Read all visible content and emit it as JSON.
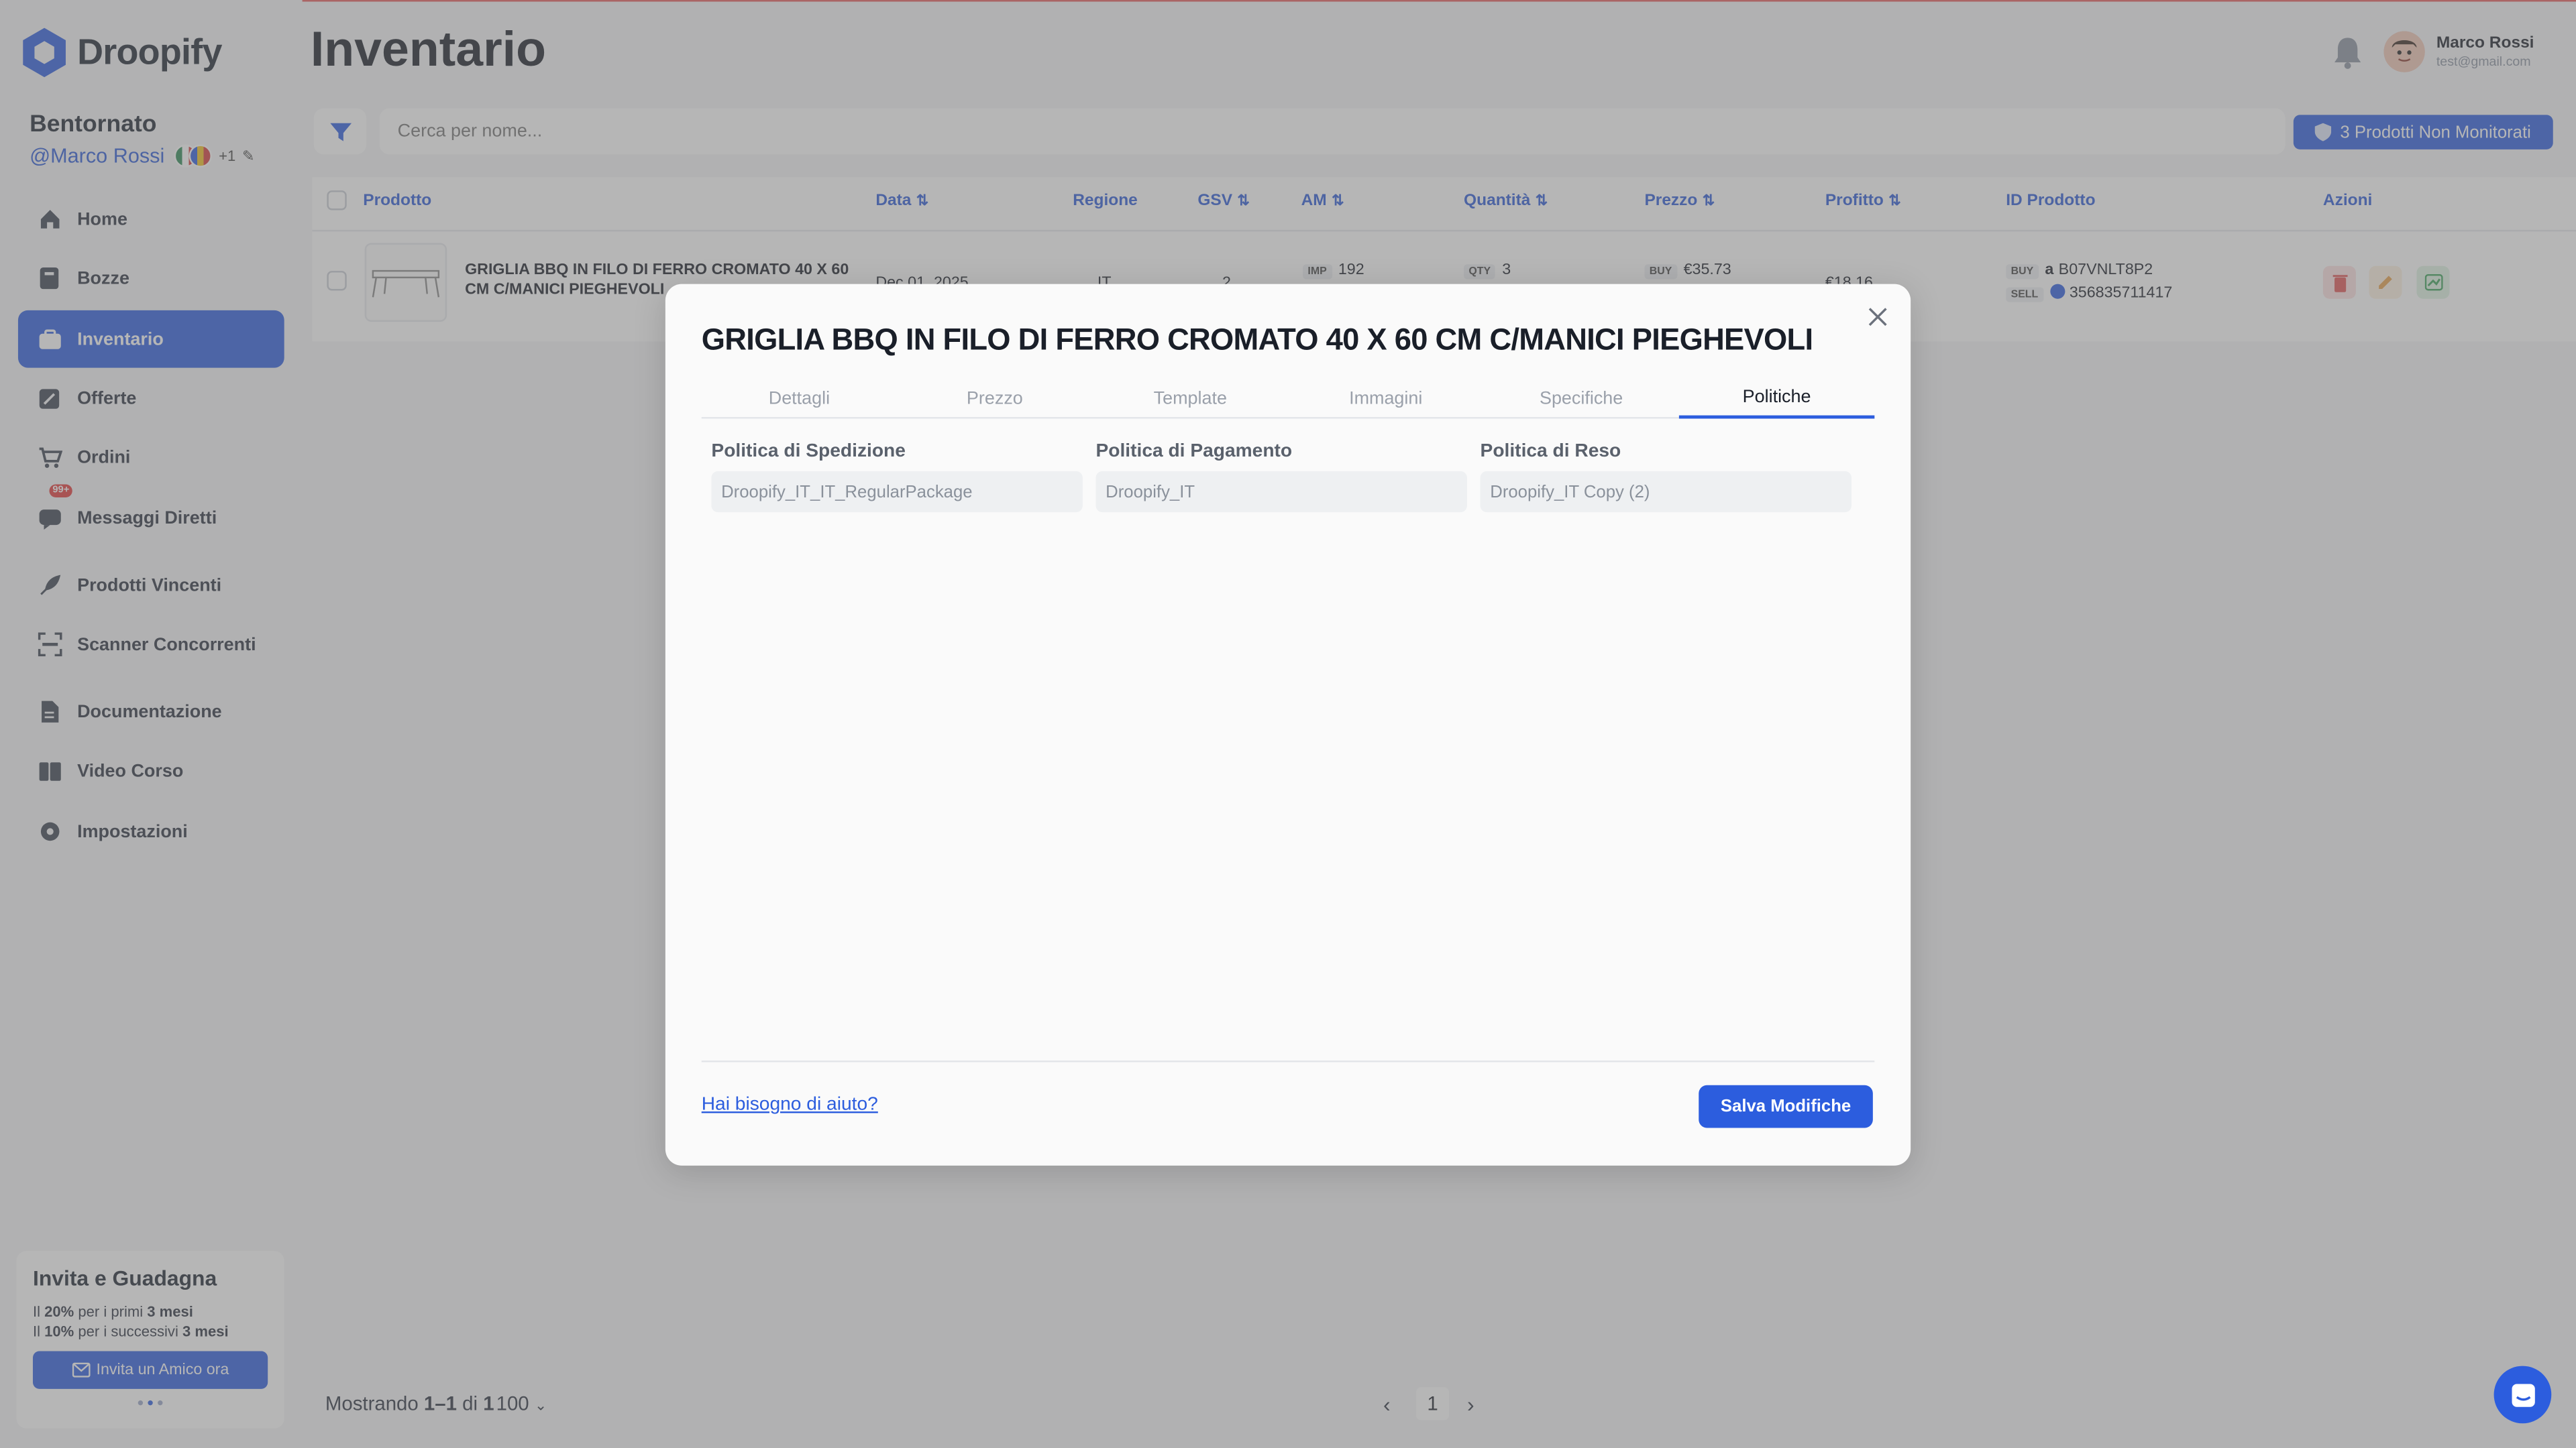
{
  "app": {
    "name": "Droopify"
  },
  "sidebar": {
    "welcome": "Bentornato",
    "user_handle": "@Marco Rossi",
    "flags_extra": "+1",
    "items": [
      {
        "label": "Home",
        "icon": "home-icon"
      },
      {
        "label": "Bozze",
        "icon": "drafts-icon"
      },
      {
        "label": "Inventario",
        "icon": "inventory-icon",
        "active": true
      },
      {
        "label": "Offerte",
        "icon": "offers-icon"
      },
      {
        "label": "Ordini",
        "icon": "cart-icon"
      },
      {
        "label": "Messaggi Diretti",
        "icon": "messages-icon",
        "badge": "99+"
      },
      {
        "label": "Prodotti Vincenti",
        "icon": "rocket-icon"
      },
      {
        "label": "Scanner Concorrenti",
        "icon": "scanner-icon"
      },
      {
        "label": "Documentazione",
        "icon": "document-icon"
      },
      {
        "label": "Video Corso",
        "icon": "video-icon"
      },
      {
        "label": "Impostazioni",
        "icon": "gear-icon"
      }
    ],
    "invite": {
      "title": "Invita e Guadagna",
      "line1_pre": "Il ",
      "line1_pct": "20%",
      "line1_mid": " per i primi ",
      "line1_dur": "3 mesi",
      "line2_pre": "Il ",
      "line2_pct": "10%",
      "line2_mid": " per i successivi ",
      "line2_dur": "3 mesi",
      "button": "Invita un Amico ora"
    }
  },
  "header": {
    "title": "Inventario",
    "user_name": "Marco Rossi",
    "user_email": "test@gmail.com"
  },
  "toolbar": {
    "search_placeholder": "Cerca per nome...",
    "unmonitored_button": "3 Prodotti Non Monitorati"
  },
  "table": {
    "columns": [
      "Prodotto",
      "Data",
      "Regione",
      "GSV",
      "AM",
      "Quantità",
      "Prezzo",
      "Profitto",
      "ID Prodotto",
      "Azioni"
    ],
    "rows": [
      {
        "product": "GRIGLIA BBQ IN FILO DI FERRO CROMATO 40 X 60 CM C/MANICI PIEGHEVOLI",
        "date": "Dec 01, 2025",
        "region": "IT",
        "gsv": "2",
        "am_chip": "IMP",
        "am": "192",
        "qty_chip": "QTY",
        "qty": "3",
        "price_chip": "BUY",
        "price": "€35.73",
        "profit": "€18.16",
        "buy_chip": "BUY",
        "buy_id": "B07VNLT8P2",
        "sell_chip": "SELL",
        "sell_id": "356835711417"
      }
    ]
  },
  "pagination": {
    "showing_pre": "Mostrando ",
    "range": "1–1",
    "of": " di ",
    "total": "1",
    "per_page": "100",
    "page": "1"
  },
  "modal": {
    "title": "GRIGLIA BBQ IN FILO DI FERRO CROMATO 40 X 60 CM C/MANICI PIEGHEVOLI",
    "tabs": [
      "Dettagli",
      "Prezzo",
      "Template",
      "Immagini",
      "Specifiche",
      "Politiche"
    ],
    "active_tab": "Politiche",
    "fields": [
      {
        "label": "Politica di Spedizione",
        "value": "Droopify_IT_IT_RegularPackage"
      },
      {
        "label": "Politica di Pagamento",
        "value": "Droopify_IT"
      },
      {
        "label": "Politica di Reso",
        "value": "Droopify_IT Copy (2)"
      }
    ],
    "help_link": "Hai bisogno di aiuto?",
    "save_button": "Salva Modifiche"
  },
  "colors": {
    "accent": "#2c5dde",
    "overlay": "rgba(110,110,110,0.5)"
  }
}
